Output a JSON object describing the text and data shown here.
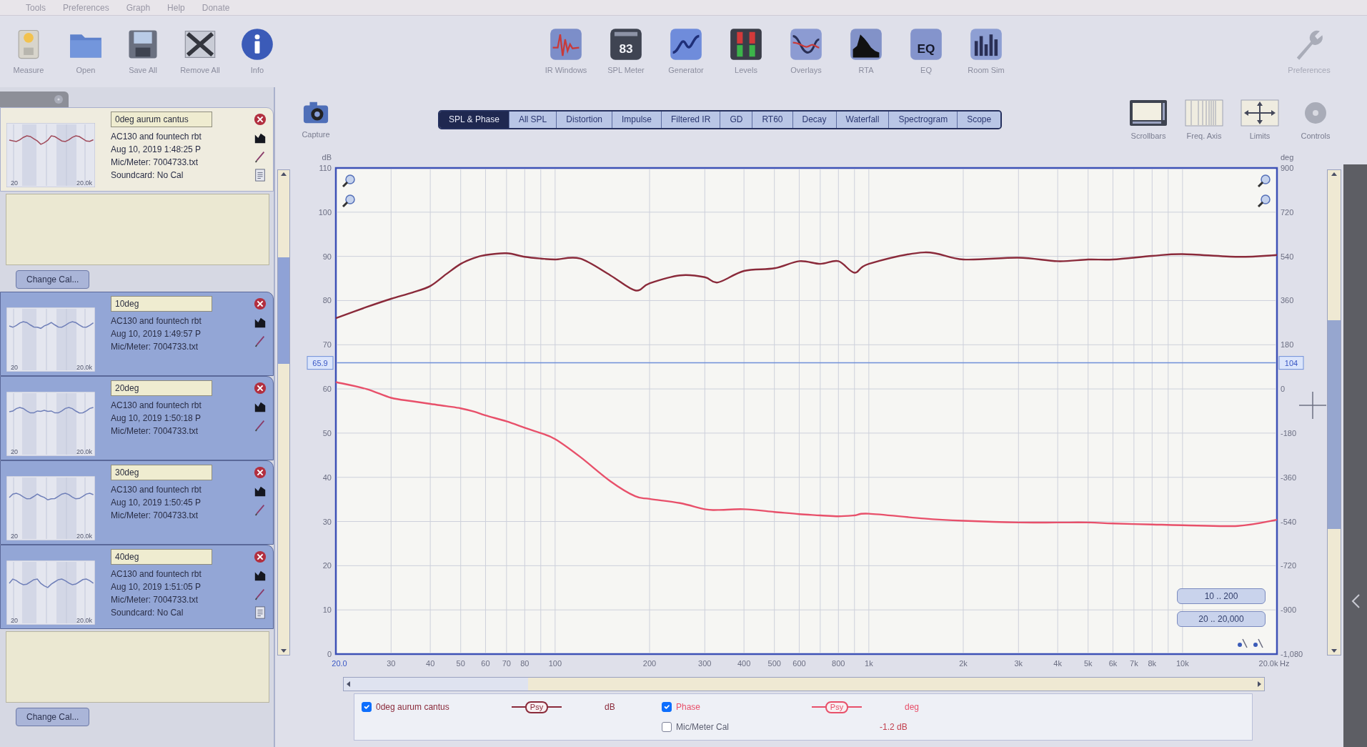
{
  "menu": [
    "Tools",
    "Preferences",
    "Graph",
    "Help",
    "Donate"
  ],
  "toolbar": {
    "left": [
      {
        "label": "Measure",
        "kind": "measure"
      },
      {
        "label": "Open",
        "kind": "open"
      },
      {
        "label": "Save All",
        "kind": "save_all"
      },
      {
        "label": "Remove All",
        "kind": "remove_all"
      },
      {
        "label": "Info",
        "kind": "info"
      }
    ],
    "center": [
      {
        "label": "IR Windows",
        "kind": "ir_windows"
      },
      {
        "label": "SPL Meter",
        "kind": "spl_meter",
        "icon_text": "83"
      },
      {
        "label": "Generator",
        "kind": "generator"
      },
      {
        "label": "Levels",
        "kind": "levels"
      },
      {
        "label": "Overlays",
        "kind": "overlays"
      },
      {
        "label": "RTA",
        "kind": "rta"
      },
      {
        "label": "EQ",
        "kind": "eq",
        "icon_text": "EQ"
      },
      {
        "label": "Room Sim",
        "kind": "room_sim"
      }
    ],
    "right": [
      {
        "label": "Preferences",
        "kind": "wrench"
      }
    ]
  },
  "measurements": [
    {
      "name": "0deg aurum cantus",
      "lines": [
        "AC130 and fountech rbt",
        "Aug 10, 2019 1:48:25 P",
        "Mic/Meter: 7004733.txt",
        "Soundcard: No Cal"
      ],
      "thumb_labels": [
        "20",
        "20.0k"
      ],
      "selected": true,
      "expanded": true,
      "change_cal": "Change Cal..."
    },
    {
      "name": "10deg",
      "lines": [
        "AC130 and fountech rbt",
        "Aug 10, 2019 1:49:57 P",
        "Mic/Meter: 7004733.txt"
      ],
      "thumb_labels": [
        "20",
        "20.0k"
      ],
      "selected": false,
      "expanded": false
    },
    {
      "name": "20deg",
      "lines": [
        "AC130 and fountech rbt",
        "Aug 10, 2019 1:50:18 P",
        "Mic/Meter: 7004733.txt"
      ],
      "thumb_labels": [
        "20",
        "20.0k"
      ],
      "selected": false,
      "expanded": false
    },
    {
      "name": "30deg",
      "lines": [
        "AC130 and fountech rbt",
        "Aug 10, 2019 1:50:45 P",
        "Mic/Meter: 7004733.txt"
      ],
      "thumb_labels": [
        "20",
        "20.0k"
      ],
      "selected": false,
      "expanded": false
    },
    {
      "name": "40deg",
      "lines": [
        "AC130 and fountech rbt",
        "Aug 10, 2019 1:51:05 P",
        "Mic/Meter: 7004733.txt",
        "Soundcard: No Cal"
      ],
      "thumb_labels": [
        "20",
        "20.0k"
      ],
      "selected": false,
      "expanded": true,
      "change_cal": "Change Cal..."
    }
  ],
  "capture_button": {
    "label": "Capture",
    "kind": "camera"
  },
  "graph_tabs": [
    {
      "label": "SPL & Phase",
      "selected": true
    },
    {
      "label": "All SPL",
      "selected": false
    },
    {
      "label": "Distortion",
      "selected": false
    },
    {
      "label": "Impulse",
      "selected": false
    },
    {
      "label": "Filtered IR",
      "selected": false
    },
    {
      "label": "GD",
      "selected": false
    },
    {
      "label": "RT60",
      "selected": false
    },
    {
      "label": "Decay",
      "selected": false
    },
    {
      "label": "Waterfall",
      "selected": false
    },
    {
      "label": "Spectrogram",
      "selected": false
    },
    {
      "label": "Scope",
      "selected": false
    }
  ],
  "graph_tools": [
    {
      "label": "Scrollbars",
      "kind": "scrollbars"
    },
    {
      "label": "Freq. Axis",
      "kind": "freq_axis"
    },
    {
      "label": "Limits",
      "kind": "limits"
    },
    {
      "label": "Controls",
      "kind": "controls"
    }
  ],
  "graph": {
    "chart_data": {
      "type": "line",
      "log": "x",
      "grid": true,
      "xlabel": "Hz",
      "ylabel": "dB",
      "y2label": "deg",
      "xlim": [
        20,
        20000
      ],
      "ylim": [
        0,
        110
      ],
      "y2lim": [
        -1080,
        900
      ],
      "xticks": [
        {
          "value": 20,
          "label": "20.0"
        },
        30,
        40,
        50,
        60,
        70,
        80,
        100,
        200,
        300,
        400,
        500,
        600,
        800,
        {
          "value": 1000,
          "label": "1k"
        },
        {
          "value": 2000,
          "label": "2k"
        },
        {
          "value": 3000,
          "label": "3k"
        },
        {
          "value": 4000,
          "label": "4k"
        },
        {
          "value": 5000,
          "label": "5k"
        },
        {
          "value": 6000,
          "label": "6k"
        },
        {
          "value": 7000,
          "label": "7k"
        },
        {
          "value": 8000,
          "label": "8k"
        },
        {
          "value": 10000,
          "label": "10k"
        },
        {
          "value": 20000,
          "label": "20.0k"
        }
      ],
      "yticks": [
        0,
        10,
        20,
        30,
        40,
        50,
        60,
        70,
        80,
        90,
        100,
        110
      ],
      "y2ticks": [
        900,
        720,
        540,
        360,
        180,
        0,
        -180,
        -360,
        -540,
        -720,
        -900,
        {
          "value": -1080,
          "label": "-1,080"
        }
      ],
      "x": [
        20,
        25,
        30,
        35,
        40,
        45,
        50,
        55,
        60,
        70,
        80,
        90,
        100,
        120,
        150,
        180,
        200,
        250,
        300,
        330,
        400,
        500,
        600,
        700,
        800,
        900,
        1000,
        1500,
        2000,
        3000,
        4000,
        5000,
        6000,
        8000,
        10000,
        15000,
        20000
      ],
      "series": [
        {
          "name": "0deg aurum cantus",
          "color": "#8a2a3a",
          "values": [
            76,
            78.5,
            80.4,
            81.8,
            83.3,
            86,
            88.3,
            89.6,
            90.3,
            90.7,
            89.9,
            89.5,
            89.3,
            89.5,
            85.7,
            82.3,
            83.9,
            85.7,
            85.3,
            84.1,
            86.7,
            87.3,
            88.9,
            88.3,
            88.9,
            86.3,
            88.3,
            90.9,
            89.3,
            89.7,
            88.9,
            89.3,
            89.3,
            90.1,
            90.5,
            89.9,
            90.3
          ]
        },
        {
          "name": "Phase",
          "color": "#e8506a",
          "axis": "y2",
          "values": [
            28,
            0,
            -36,
            -50,
            -61,
            -70,
            -79,
            -92,
            -108,
            -132,
            -158,
            -180,
            -204,
            -276,
            -376,
            -437,
            -448,
            -465,
            -490,
            -493,
            -490,
            -501,
            -510,
            -515,
            -519,
            -515,
            -508,
            -528,
            -537,
            -544,
            -544,
            -544,
            -548,
            -552,
            -555,
            -558,
            -533
          ]
        }
      ],
      "ref_lines": [
        {
          "axis": "y",
          "value": 65.9,
          "label": "65.9",
          "color": "#6f8fd8"
        }
      ]
    },
    "right_readout": "104",
    "range_buttons": [
      "10 .. 200",
      "20 .. 20,000"
    ]
  },
  "legend": {
    "columns": [
      [
        {
          "kind": "trace",
          "checked": true,
          "style": "Psy",
          "unit": "dB"
        }
      ],
      [
        {
          "kind": "trace",
          "checked": true,
          "style": "Psy",
          "unit": "deg"
        },
        {
          "kind": "offset",
          "checked": false,
          "label": "Mic/Meter Cal",
          "value": "-1.2 dB"
        }
      ]
    ]
  }
}
